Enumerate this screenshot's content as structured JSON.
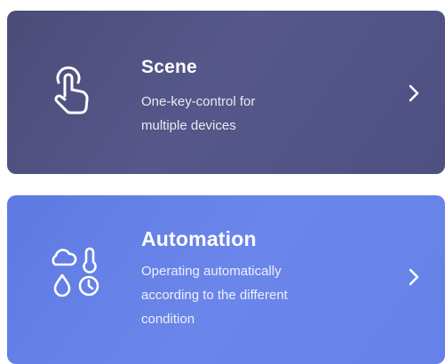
{
  "cards": {
    "scene": {
      "icon": "hand-tap-icon",
      "title": "Scene",
      "description_line1": "One-key-control for",
      "description_line2": "multiple devices",
      "chevron": "chevron-right-icon"
    },
    "automation": {
      "icon": "weather-conditions-icon",
      "title": "Automation",
      "description_line1": "Operating automatically",
      "description_line2": "according to the different",
      "description_line3": "condition",
      "chevron": "chevron-right-icon"
    }
  },
  "colors": {
    "scene_bg": "#50527f",
    "automation_bg": "#657fe6",
    "text": "#ffffff"
  }
}
